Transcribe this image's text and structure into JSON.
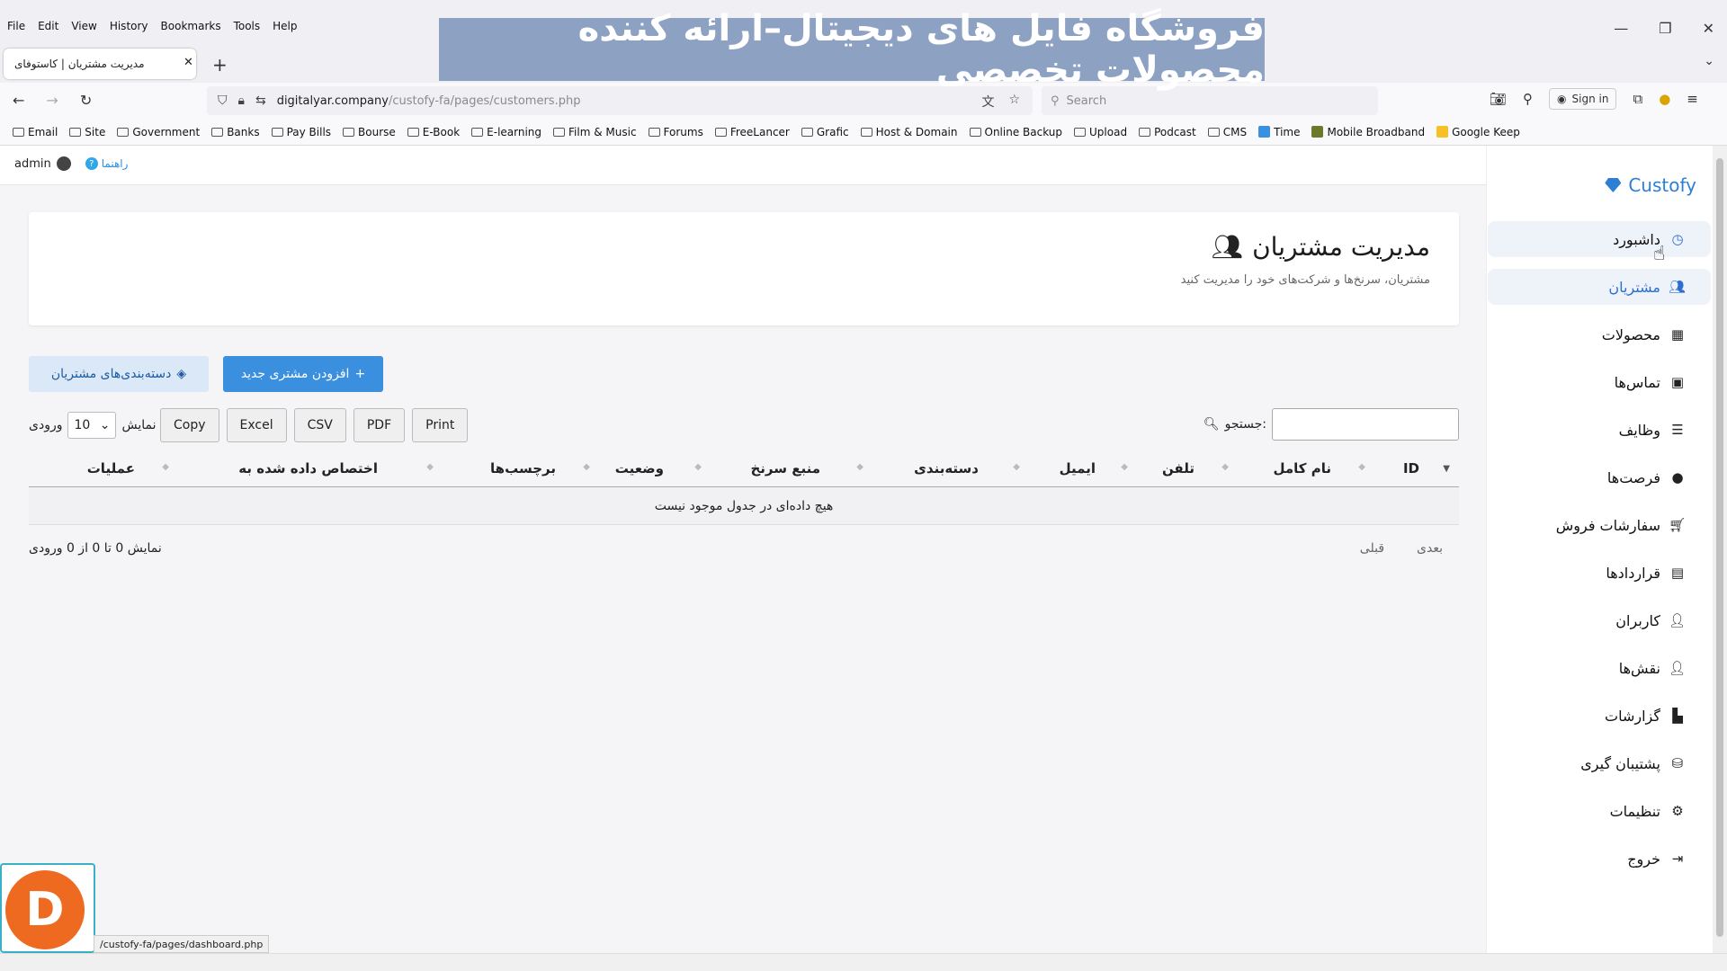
{
  "browser": {
    "menus": [
      "File",
      "Edit",
      "View",
      "History",
      "Bookmarks",
      "Tools",
      "Help"
    ],
    "banner_text": "فروشگاه فایل های دیجیتال–ارائه کننده محصولات تخصصی",
    "tab_title": "مدیریت مشتریان | کاستوفای",
    "url_host": "digitalyar.company",
    "url_path": "/custofy-fa/pages/customers.php",
    "search_placeholder": "Search",
    "signin_label": "Sign in",
    "bookmarks": [
      "Email",
      "Site",
      "Government",
      "Banks",
      "Pay Bills",
      "Bourse",
      "E-Book",
      "E-learning",
      "Film & Music",
      "Forums",
      "FreeLancer",
      "Grafic",
      "Host & Domain",
      "Online Backup",
      "Upload",
      "Podcast",
      "CMS",
      "Time",
      "Mobile Broadband",
      "Google Keep"
    ],
    "status_url": "/custofy-fa/pages/dashboard.php"
  },
  "topbar": {
    "user": "admin",
    "help": "راهنما"
  },
  "sidebar": {
    "brand": "Custofy",
    "items": [
      {
        "label": "داشبورد",
        "icon": "dashboard-icon"
      },
      {
        "label": "مشتریان",
        "icon": "users-icon"
      },
      {
        "label": "محصولات",
        "icon": "boxes-icon"
      },
      {
        "label": "تماس‌ها",
        "icon": "contact-book-icon"
      },
      {
        "label": "وظایف",
        "icon": "tasks-icon"
      },
      {
        "label": "فرصت‌ها",
        "icon": "lightbulb-icon"
      },
      {
        "label": "سفارشات فروش",
        "icon": "cart-icon"
      },
      {
        "label": "قراردادها",
        "icon": "contract-icon"
      },
      {
        "label": "کاربران",
        "icon": "user-gear-icon"
      },
      {
        "label": "نقش‌ها",
        "icon": "user-shield-icon"
      },
      {
        "label": "گزارشات",
        "icon": "chart-icon"
      },
      {
        "label": "پشتیبان گیری",
        "icon": "database-icon"
      },
      {
        "label": "تنظیمات",
        "icon": "gears-icon"
      },
      {
        "label": "خروج",
        "icon": "logout-icon"
      }
    ]
  },
  "page": {
    "title": "مدیریت مشتریان",
    "subtitle": "مشتریان، سرنخ‌ها و شرکت‌های خود را مدیریت کنید",
    "add_button": "افزودن مشتری جدید",
    "categories_button": "دسته‌بندی‌های مشتریان"
  },
  "table": {
    "search_label": ":جستجو",
    "show_label": "نمایش",
    "entries_label": "ورودی",
    "page_length": "10",
    "export_buttons": [
      "Copy",
      "Excel",
      "CSV",
      "PDF",
      "Print"
    ],
    "columns": [
      "ID",
      "نام کامل",
      "تلفن",
      "ایمیل",
      "دسته‌بندی",
      "منبع سرنخ",
      "وضعیت",
      "برچسب‌ها",
      "اختصاص داده شده به",
      "عملیات"
    ],
    "empty_message": "هیچ داده‌ای در جدول موجود نیست",
    "info": "نمایش 0 تا 0 از 0 ورودی",
    "next": "بعدی",
    "prev": "قبلی"
  },
  "logo_letter": "D"
}
